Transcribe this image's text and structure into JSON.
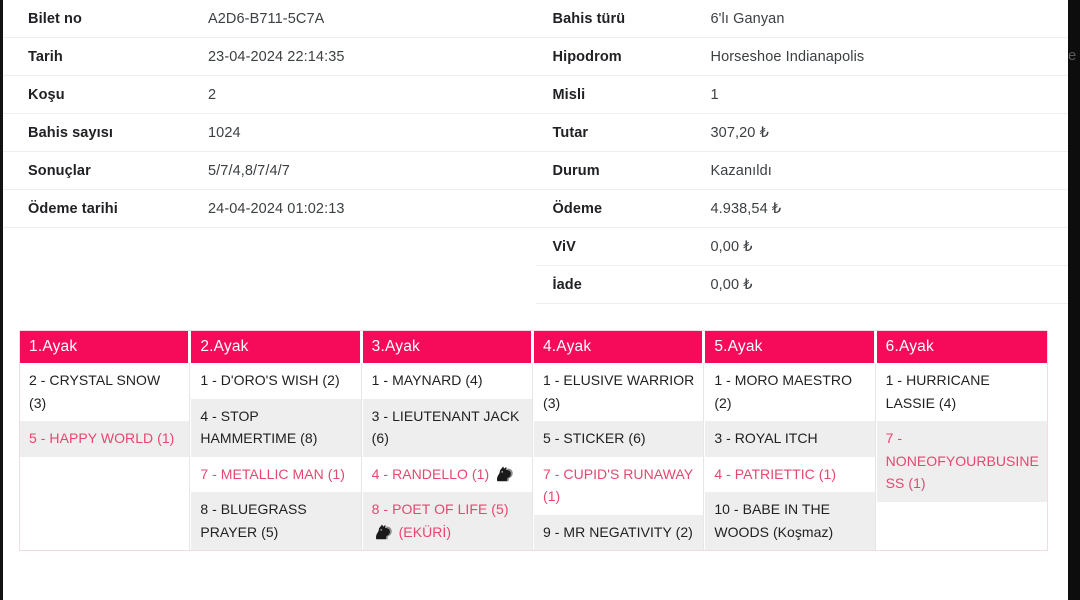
{
  "theme": {
    "accent_pink": "#f50b5a",
    "win_text": "#e5476f",
    "row_shade": "#eeeeee",
    "text": "#212121"
  },
  "info": {
    "left_rows": [
      {
        "label": "Bilet no",
        "value": "A2D6-B711-5C7A"
      },
      {
        "label": "Tarih",
        "value": "23-04-2024 22:14:35"
      },
      {
        "label": "Koşu",
        "value": "2"
      },
      {
        "label": "Bahis sayısı",
        "value": "1024"
      },
      {
        "label": "Sonuçlar",
        "value": "5/7/4,8/7/4/7"
      },
      {
        "label": "Ödeme tarihi",
        "value": "24-04-2024 01:02:13"
      }
    ],
    "right_rows": [
      {
        "label": "Bahis türü",
        "value": "6'lı Ganyan"
      },
      {
        "label": "Hipodrom",
        "value": "Horseshoe Indianapolis"
      },
      {
        "label": "Misli",
        "value": "1"
      },
      {
        "label": "Tutar",
        "value": "307,20 ₺"
      },
      {
        "label": "Durum",
        "value": "Kazanıldı"
      },
      {
        "label": "Ödeme",
        "value": "4.938,54 ₺"
      },
      {
        "label": "ViV",
        "value": "0,00 ₺"
      },
      {
        "label": "İade",
        "value": "0,00 ₺"
      }
    ]
  },
  "legs": [
    {
      "header": "1.Ayak",
      "horses": [
        {
          "text": "2 - CRYSTAL SNOW (3)",
          "win": false,
          "shaded": false,
          "icon": false
        },
        {
          "text": "5 - HAPPY WORLD (1)",
          "win": true,
          "shaded": true,
          "icon": false
        }
      ],
      "fill_shaded": false
    },
    {
      "header": "2.Ayak",
      "horses": [
        {
          "text": "1 - D'ORO'S WISH (2)",
          "win": false,
          "shaded": false,
          "icon": false
        },
        {
          "text": "4 - STOP HAMMERTIME (8)",
          "win": false,
          "shaded": true,
          "icon": false
        },
        {
          "text": "7 - METALLIC MAN (1)",
          "win": true,
          "shaded": false,
          "icon": false
        },
        {
          "text": "8 - BLUEGRASS PRAYER (5)",
          "win": false,
          "shaded": true,
          "icon": false
        }
      ],
      "fill_shaded": true
    },
    {
      "header": "3.Ayak",
      "horses": [
        {
          "text": "1 - MAYNARD (4)",
          "win": false,
          "shaded": false,
          "icon": false
        },
        {
          "text": "3 - LIEUTENANT JACK (6)",
          "win": false,
          "shaded": true,
          "icon": false
        },
        {
          "text": "4 - RANDELLO (1)",
          "win": true,
          "shaded": false,
          "icon": true,
          "icon_name": "horse-head-icon",
          "icon_pos": "after"
        },
        {
          "text": "8 - POET OF LIFE (5)",
          "win": true,
          "shaded": true,
          "icon": true,
          "icon_name": "horse-head-icon",
          "icon_pos": "after",
          "suffix": "(EKÜRİ)"
        }
      ],
      "fill_shaded": true
    },
    {
      "header": "4.Ayak",
      "horses": [
        {
          "text": "1 - ELUSIVE WARRIOR (3)",
          "win": false,
          "shaded": false,
          "icon": false
        },
        {
          "text": "5 - STICKER (6)",
          "win": false,
          "shaded": true,
          "icon": false
        },
        {
          "text": "7 - CUPID'S RUNAWAY (1)",
          "win": true,
          "shaded": false,
          "icon": false
        },
        {
          "text": "9 - MR NEGATIVITY (2)",
          "win": false,
          "shaded": true,
          "icon": false
        }
      ],
      "fill_shaded": true
    },
    {
      "header": "5.Ayak",
      "horses": [
        {
          "text": "1 - MORO MAESTRO (2)",
          "win": false,
          "shaded": false,
          "icon": false
        },
        {
          "text": "3 - ROYAL ITCH",
          "win": false,
          "shaded": true,
          "icon": false
        },
        {
          "text": "4 - PATRIETTIC (1)",
          "win": true,
          "shaded": false,
          "icon": false
        },
        {
          "text": "10 - BABE IN THE WOODS (Koşmaz)",
          "win": false,
          "shaded": true,
          "icon": false
        }
      ],
      "fill_shaded": true
    },
    {
      "header": "6.Ayak",
      "horses": [
        {
          "text": "1 - HURRICANE LASSIE (4)",
          "win": false,
          "shaded": false,
          "icon": false
        },
        {
          "text": "7 - NONEOFYOURBUSINESS (1)",
          "win": true,
          "shaded": true,
          "icon": false
        }
      ],
      "fill_shaded": false
    }
  ],
  "edge": {
    "right_glyph": "e"
  }
}
